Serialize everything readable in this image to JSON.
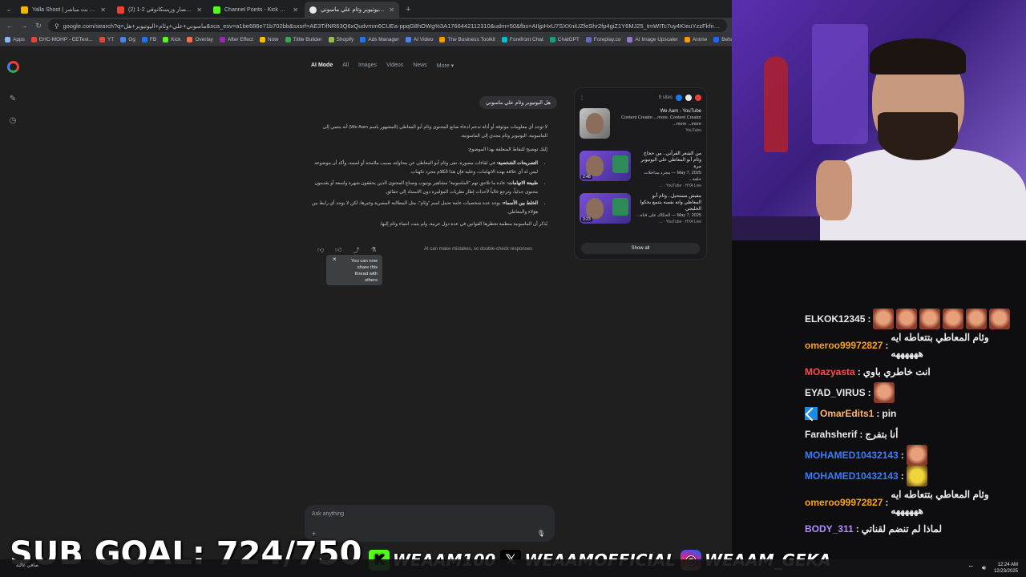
{
  "tabs": [
    {
      "label": "Yalla Shoot | ماتشات اليوم بث مباشر",
      "color": "#f4b400"
    },
    {
      "label": "(2) أهداف حصار وزيسكانوفي 2-1 - ...",
      "color": "#ea4335"
    },
    {
      "label": "Channel Points - Kick Dashboa...",
      "color": "#53fc18"
    },
    {
      "label": "هل اليوتيوبر وئام علي ماسوني...",
      "color": "#e8eaed"
    }
  ],
  "new_tab": "+",
  "url": "google.com/search?q=ماسوني+علي+وئام+اليوتيوبر+هل&sca_esv=a1be686e71b702bb&sxsrf=AE3TifNR63Q6xQudvmm6CUEa-ppqG8hOWg%3A1766442112310&udm=50&fbs=AIIjpHxU7SXXniUZfeShr2fp4giZ1Y6MJ25_tmWITc7uy4KIeuYzzFkfneXafNx6OMdA4MQRJc_t_TQ",
  "bookmarks": [
    "Apps",
    "EHC-MOHP - EETest...",
    "YT",
    "Gg",
    "FB",
    "Kick",
    "Overlay",
    "After Effect",
    "Note",
    "Tittle Builder",
    "Shopify",
    "Ads Manager",
    "AI Video",
    "The Business Toolkit",
    "Forefront Chat",
    "ChatGPT",
    "Foreplay.co",
    "AI Image Upscaler",
    "Anime",
    "Behance"
  ],
  "mode_tabs": {
    "ai_mode": "AI Mode",
    "all": "All",
    "images": "Images",
    "videos": "Videos",
    "news": "News",
    "more": "More"
  },
  "user_query": "هل اليوتيوبر وئام علي ماسوني",
  "answer": {
    "intro": "لا توجد أي معلومات موثوقة أو أدلة تدعم ادعاء صانع المحتوى وئام أبو المعاطي (المشهور باسم We Aam) أنه ينتمي إلى الماسونية.",
    "intro2": "اليوتيوبر وئام مجدي إلى الماسونية.",
    "lead": "إليك توضيح للنقاط المتعلقة بهذا الموضوع:",
    "b1_head": "التصريحات الشخصية:",
    "b1_text": "في لقاءات مصورة، نفى وئام أبو المعاطي عن محاولته بسبب ملامحه أو اسمه، وأكد أن موضوعه ليس له أي علاقة بهذه الاتهامات، وعليه فإن هذا الكلام مجرد تكهنات.",
    "b2_head": "طبيعة الاتهامات:",
    "b2_text": "عادة ما تلاحق تهم \"الماسونية\" مشاهير يوتيوب وصناع المحتوى الذين يحققون شهرة واسعة أو يقدمون محتوى جدلياً، وترجع غالباً لأحداث إطار نظريات المؤامرة دون الاستناد إلى حقائق.",
    "b3_head": "الخلط بين الأسماء:",
    "b3_text": "يوجد عدة شخصيات عامة تحمل اسم \"وئام\"، مثل المطالبة المصرية وغيرها، لكن لا يوجد أي رابط بين هؤلاء والمعاطي.",
    "outro": "يُذكر أن الماسونية منظمة تحظرها القوانين في عدة دول عربية، ولم يثبت انتماء وئام إليها."
  },
  "toast": {
    "text": "You can now share this thread with others",
    "close": "×"
  },
  "disclaimer": "AI can make mistakes, so double-check responses",
  "sources": {
    "count_label": "9 sites",
    "items": [
      {
        "title": "We Aam - YouTube",
        "desc": "Content Creator ...more. Content Creator ...more ...more",
        "meta": "YouTube",
        "duration": ""
      },
      {
        "title": "من الشعر القرآني.. من حجاج وئام أبو المعاطي على اليوتيوبر مرة",
        "desc": "May 7, 2025 — مجرد مداخلات حلقة...",
        "meta": "YouTube · HYA Live · ...",
        "duration": "2:48"
      },
      {
        "title": "مقيش مستحيل.. وئام أبو المعاطي وانه نفسه يتنمع بحكوا الخليجي",
        "desc": "May 7, 2025 — الحكاك على قناة...",
        "meta": "YouTube · HYA Live · ...",
        "duration": "3:23"
      }
    ],
    "show_all": "Show all"
  },
  "ask": {
    "placeholder": "Ask anything",
    "plus": "+"
  },
  "chat": [
    {
      "user": "ELKOK12345",
      "color": "#e8eaed",
      "text": "",
      "emotes": 6
    },
    {
      "user": "omeroo99972827",
      "color": "#ffa500",
      "text": "وئام المعاطي بتتعاطه ايه ههههههه",
      "emotes": 0
    },
    {
      "user": "MOazyasta",
      "color": "#ff4a4a",
      "text": "انت خاطري باوي",
      "emotes": 0
    },
    {
      "user": "EYAD_VIRUS",
      "color": "#e8eaed",
      "text": "",
      "emotes": 1
    },
    {
      "user": "OmarEdits1",
      "color": "#ffb36b",
      "text": "pin",
      "emotes": 0
    },
    {
      "user": "Farahsherif",
      "color": "#e8eaed",
      "text": "أنا بتفرج",
      "emotes": 0
    },
    {
      "user": "MOHAMED10432143",
      "color": "#3c7bff",
      "text": "",
      "emotes": 1
    },
    {
      "user": "MOHAMED10432143",
      "color": "#3c7bff",
      "text": "",
      "emotes": 1,
      "yellow": true
    },
    {
      "user": "omeroo99972827",
      "color": "#ffa500",
      "text": "وئام المعاطي بتتعاطه ايه ههههههه",
      "emotes": 0
    },
    {
      "user": "BODY_311",
      "color": "#b28cff",
      "text": "لماذا لم تنضم لقناتي",
      "emotes": 0
    }
  ],
  "overlay": {
    "subgoal": "SUB GOAL: 724/750",
    "kick": "WEAAM100",
    "x": "WEAAMOFFICIAL",
    "instagram": "WEAAM_GEKA"
  },
  "taskbar": {
    "weather": "صافي غالبة",
    "time": "12:24 AM",
    "date": "12/23/2025"
  },
  "icons": {
    "back": "arrow-left-icon",
    "forward": "arrow-right-icon",
    "reload": "reload-icon",
    "mic": "mic-icon"
  }
}
